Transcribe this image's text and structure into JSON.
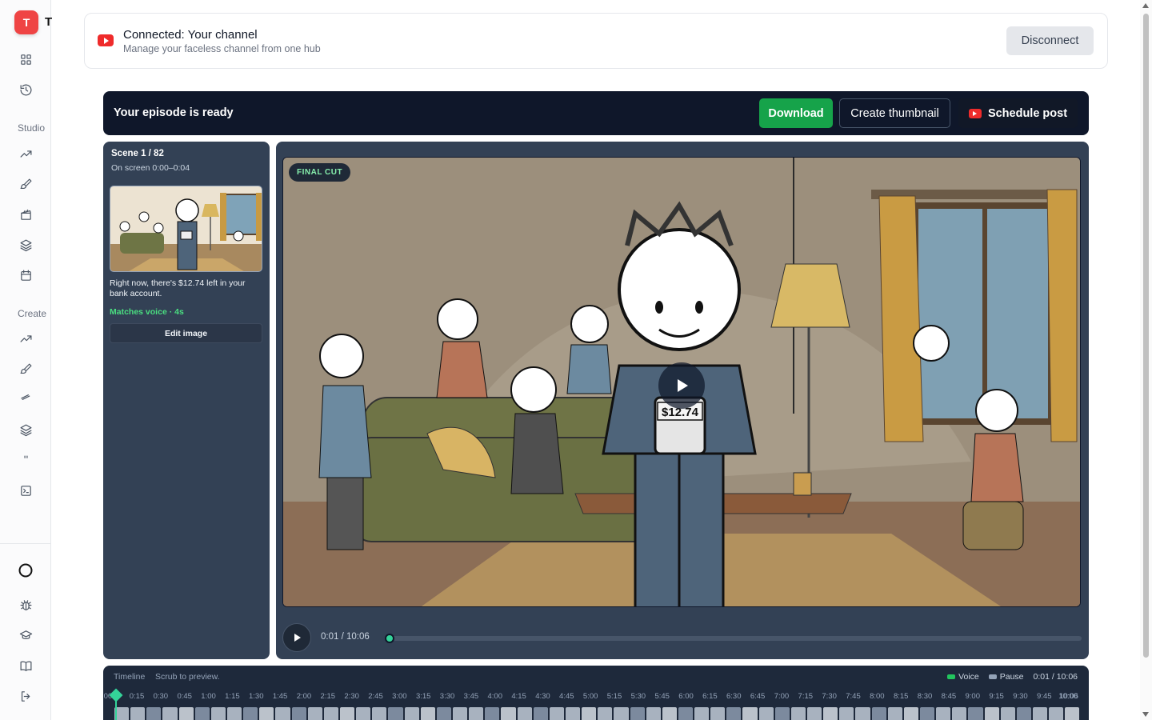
{
  "app": {
    "logo_letter": "T",
    "logo_text": "T"
  },
  "sidebar": {
    "top_icons": [
      "grid-icon",
      "history-icon"
    ],
    "sections": [
      {
        "label": "Studio",
        "icons": [
          "trending-icon",
          "brush-icon",
          "clapperboard-icon",
          "layers-icon",
          "calendar-icon"
        ]
      },
      {
        "label": "Create",
        "icons": [
          "trending-icon",
          "brush-icon",
          "wand-icon",
          "layers-icon",
          "more-icon",
          "terminal-icon"
        ]
      }
    ],
    "bottom_icons": [
      "circle-icon",
      "bug-icon",
      "graduation-cap-icon",
      "book-icon",
      "logout-icon"
    ]
  },
  "connection": {
    "title": "Connected: Your channel",
    "subtitle": "Manage your faceless channel from one hub",
    "disconnect_label": "Disconnect"
  },
  "ready_bar": {
    "label": "Your episode is ready",
    "download_label": "Download",
    "thumbnail_label": "Create thumbnail",
    "schedule_label": "Schedule post"
  },
  "scene": {
    "title": "Scene 1 / 82",
    "time": "On screen 0:00–0:04",
    "caption": "Right now, there's $12.74 left in your bank account.",
    "match": "Matches voice · 4s",
    "edit_label": "Edit image"
  },
  "player": {
    "badge": "FINAL CUT",
    "sign_text": "$12.74",
    "time_display": "0:01 / 10:06",
    "progress_fraction": 0.0017
  },
  "timeline": {
    "label": "Timeline",
    "hint": "Scrub to preview.",
    "legend_voice": "Voice",
    "legend_pause": "Pause",
    "time_display": "0:01 / 10:06",
    "start_label": "0:00",
    "end_label": "10:06",
    "ticks": [
      "0:15",
      "0:30",
      "0:45",
      "1:00",
      "1:15",
      "1:30",
      "1:45",
      "2:00",
      "2:15",
      "2:30",
      "2:45",
      "3:00",
      "3:15",
      "3:30",
      "3:45",
      "4:00",
      "4:15",
      "4:30",
      "4:45",
      "5:00",
      "5:15",
      "5:30",
      "5:45",
      "6:00",
      "6:15",
      "6:30",
      "6:45",
      "7:00",
      "7:15",
      "7:30",
      "7:45",
      "8:00",
      "8:15",
      "8:30",
      "8:45",
      "9:00",
      "9:15",
      "9:30",
      "9:45",
      "10:00"
    ],
    "colors": {
      "voice": "#22c55e",
      "pause": "#94a3b8",
      "playhead": "#34d399"
    }
  },
  "colors": {
    "accent_green": "#16a34a",
    "navy": "#0f172a",
    "youtube_red": "#ef2b2b",
    "panel": "#334155"
  }
}
